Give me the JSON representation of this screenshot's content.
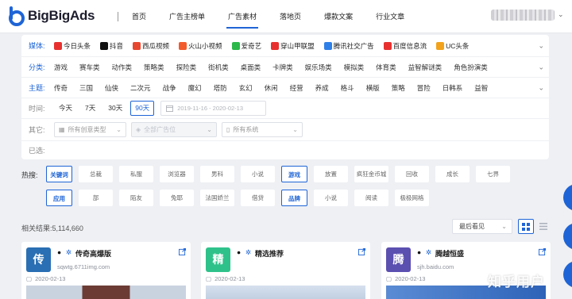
{
  "app": {
    "logo_text": "BigBigAds",
    "nav": [
      "首页",
      "广告主榜单",
      "广告素材",
      "落地页",
      "爆款文案",
      "行业文章"
    ],
    "active_nav": 2
  },
  "filters": {
    "media_label": "媒体:",
    "media": [
      {
        "label": "今日头条",
        "icon": "toutiao-icon",
        "color": "#e8312f"
      },
      {
        "label": "抖音",
        "icon": "douyin-icon",
        "color": "#111111"
      },
      {
        "label": "西瓜视频",
        "icon": "xigua-icon",
        "color": "#e8472f"
      },
      {
        "label": "火山小视频",
        "icon": "huoshan-icon",
        "color": "#f25a2c"
      },
      {
        "label": "爱奇艺",
        "icon": "iqiyi-icon",
        "color": "#2cb84a"
      },
      {
        "label": "穿山甲联盟",
        "icon": "pangle-icon",
        "color": "#e8312f"
      },
      {
        "label": "腾讯社交广告",
        "icon": "tencent-icon",
        "color": "#2f7fe8"
      },
      {
        "label": "百度信息流",
        "icon": "baidu-icon",
        "color": "#e8312f"
      },
      {
        "label": "UC头条",
        "icon": "uc-icon",
        "color": "#f2a31b"
      }
    ],
    "category_label": "分类:",
    "categories": [
      "游戏",
      "赛车类",
      "动作类",
      "策略类",
      "探险类",
      "街机类",
      "桌面类",
      "卡牌类",
      "娱乐场类",
      "模拟类",
      "体育类",
      "益智解谜类",
      "角色扮演类"
    ],
    "theme_label": "主题:",
    "themes": [
      "传奇",
      "三国",
      "仙侠",
      "二次元",
      "战争",
      "魔幻",
      "塔防",
      "玄幻",
      "休闲",
      "经营",
      "养成",
      "格斗",
      "横版",
      "策略",
      "冒险",
      "日韩系",
      "益智"
    ],
    "time_label": "时间:",
    "time_options": [
      "今天",
      "7天",
      "30天",
      "90天"
    ],
    "time_active": 3,
    "date_range": "2019-11-16 - 2020-02-13",
    "other_label": "其它:",
    "creative_type": "所有创意类型",
    "ad_position": "全部广告位",
    "system": "所有系统",
    "selected_label": "已选:"
  },
  "hot": {
    "label": "热搜:",
    "row1": {
      "tag": "关键词",
      "items": [
        "总裁",
        "私服",
        "浏览器",
        "男科",
        "小说"
      ],
      "tag2": "游戏",
      "items2": [
        "放置",
        "疯狂金币城",
        "回收",
        "成长",
        "七界"
      ]
    },
    "row2": {
      "tag": "应用",
      "items": [
        "部",
        "陌友",
        "兔耶",
        "法国娇兰",
        "借贷"
      ],
      "tag2": "品牌",
      "items2": [
        "小说",
        "阅读",
        "极极网格"
      ]
    }
  },
  "results": {
    "label": "相关结果:5,114,660",
    "sort": "最后看见"
  },
  "cards": [
    {
      "avatar": "传",
      "avatar_color": "#2a6fb3",
      "title": "传奇高爆版",
      "url": "sqwtg.6711img.com",
      "date": "2020-02-13"
    },
    {
      "avatar": "精",
      "avatar_color": "#2ec28a",
      "title": "精选推荐",
      "url": "",
      "date": "2020-02-13"
    },
    {
      "avatar": "腾",
      "avatar_color": "#5b4fb0",
      "title": "腾越恒盛",
      "url": "sjh.baidu.com",
      "date": "2020-02-13"
    }
  ],
  "watermark": "知乎用户"
}
